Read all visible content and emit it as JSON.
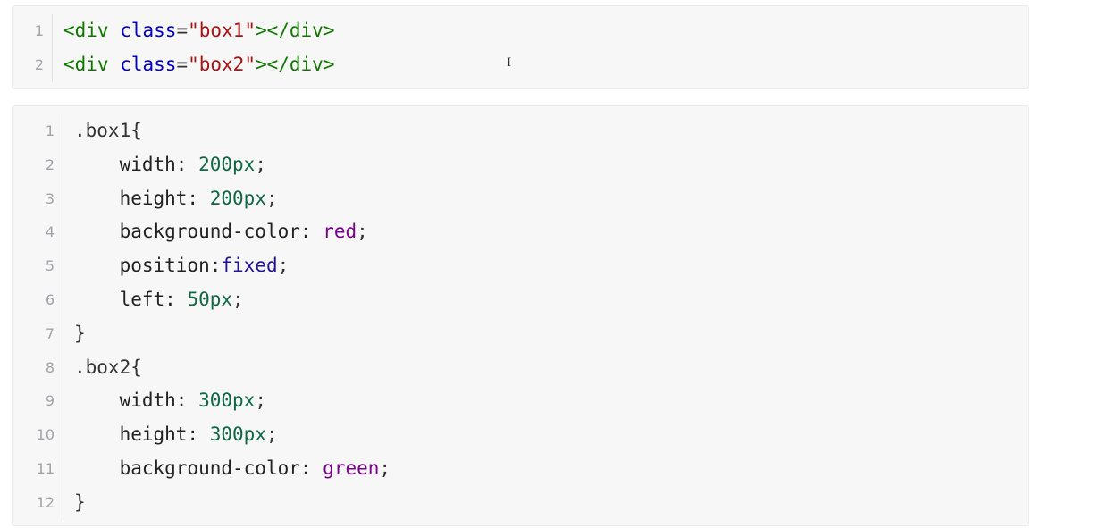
{
  "html_block": {
    "lines": [
      {
        "num": "1",
        "open": "<div",
        "attr": "class",
        "eq": "=",
        "value": "\"box1\"",
        "close": "></div>"
      },
      {
        "num": "2",
        "open": "<div",
        "attr": "class",
        "eq": "=",
        "value": "\"box2\"",
        "close": "></div>"
      }
    ]
  },
  "css_block": {
    "lines": [
      {
        "num": "1",
        "selector": ".box1{"
      },
      {
        "num": "2",
        "prop": "width:",
        "value": "200px",
        "end": ";"
      },
      {
        "num": "3",
        "prop": "height:",
        "value": "200px",
        "end": ";"
      },
      {
        "num": "4",
        "prop": "background-color:",
        "value": "red",
        "end": ";"
      },
      {
        "num": "5",
        "prop": "position:",
        "value": "fixed",
        "end": ";"
      },
      {
        "num": "6",
        "prop": "left:",
        "value": "50px",
        "end": ";"
      },
      {
        "num": "7",
        "brace": "}"
      },
      {
        "num": "8",
        "selector": ".box2{"
      },
      {
        "num": "9",
        "prop": "width:",
        "value": "300px",
        "end": ";"
      },
      {
        "num": "10",
        "prop": "height:",
        "value": "300px",
        "end": ";"
      },
      {
        "num": "11",
        "prop": "background-color:",
        "value": "green",
        "end": ";"
      },
      {
        "num": "12",
        "brace": "}"
      }
    ]
  },
  "cursor_glyph": "I",
  "colors": {
    "tag": "#117700",
    "attribute": "#0000cc",
    "string": "#aa1111",
    "number": "#116644",
    "keyword_value": "#770088",
    "keyword_blue": "#221199"
  }
}
